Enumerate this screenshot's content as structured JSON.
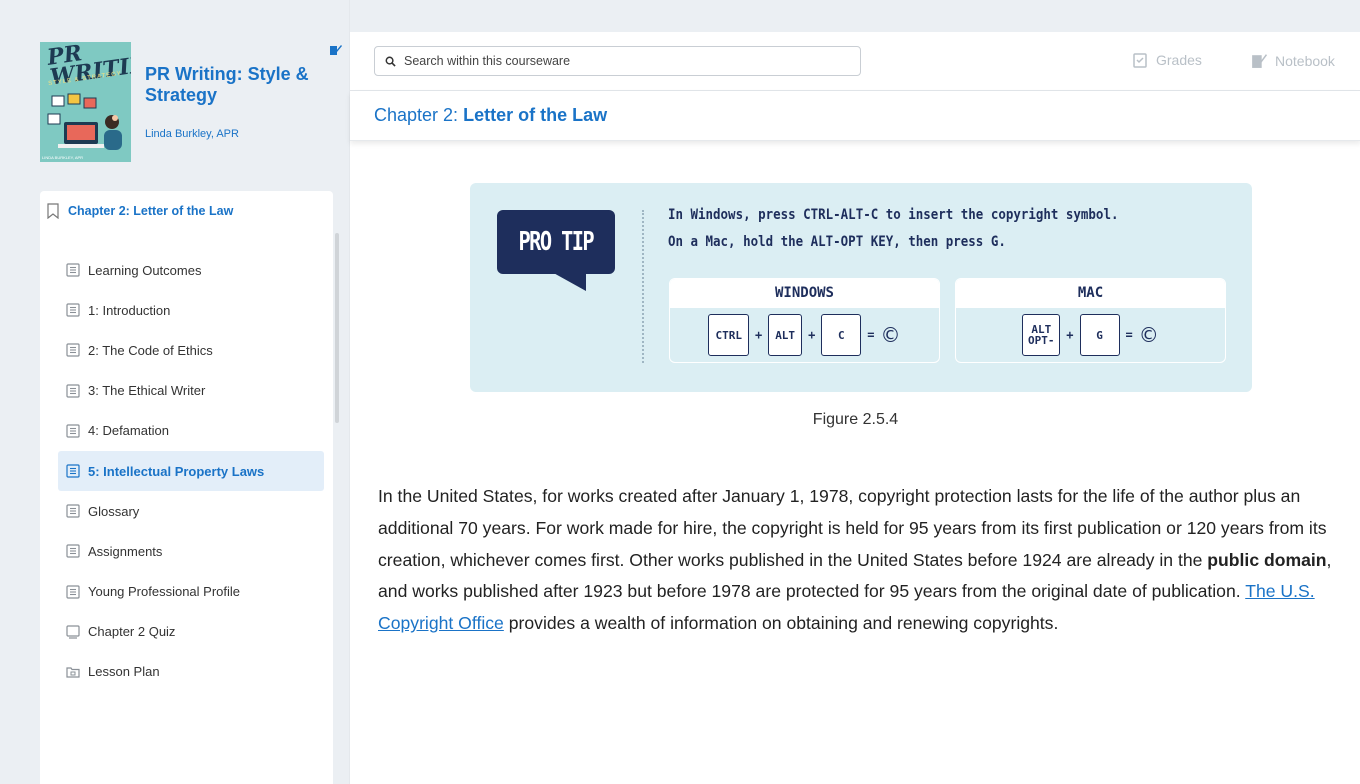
{
  "course": {
    "title": "PR Writing: Style & Strategy",
    "author": "Linda Burkley, APR",
    "cover": {
      "title": "PR WRITING",
      "subtitle": "STYLE & STRATEGY",
      "author": "LINDA BURKLEY, APR"
    }
  },
  "toc": {
    "chapter": "Chapter 2: Letter of the Law",
    "items": [
      {
        "label": "Learning Outcomes",
        "icon": "page-icon",
        "active": false
      },
      {
        "label": "1: Introduction",
        "icon": "page-icon",
        "active": false
      },
      {
        "label": "2: The Code of Ethics",
        "icon": "page-icon",
        "active": false
      },
      {
        "label": "3: The Ethical Writer",
        "icon": "page-icon",
        "active": false
      },
      {
        "label": "4: Defamation",
        "icon": "page-icon",
        "active": false
      },
      {
        "label": "5: Intellectual Property Laws",
        "icon": "page-icon",
        "active": true
      },
      {
        "label": "Glossary",
        "icon": "page-icon",
        "active": false
      },
      {
        "label": "Assignments",
        "icon": "page-icon",
        "active": false
      },
      {
        "label": "Young Professional Profile",
        "icon": "page-icon",
        "active": false
      },
      {
        "label": "Chapter 2 Quiz",
        "icon": "quiz-icon",
        "active": false
      },
      {
        "label": "Lesson Plan",
        "icon": "folder-icon",
        "active": false
      }
    ]
  },
  "toolbar": {
    "search_placeholder": "Search within this courseware",
    "grades_label": "Grades",
    "notebook_label": "Notebook"
  },
  "chapter_bar": {
    "prefix": "Chapter 2:",
    "title": "Letter of the Law"
  },
  "figure": {
    "badge": "PRO TIP",
    "line1": "In Windows, press CTRL-ALT-C to insert the copyright symbol.",
    "line2": "On a Mac, hold the ALT-OPT KEY, then press G.",
    "windows": {
      "heading": "WINDOWS",
      "keys": [
        "CTRL",
        "ALT",
        "C"
      ]
    },
    "mac": {
      "heading": "MAC",
      "keys": [
        "ALT OPT-",
        "G"
      ]
    },
    "plus": "+",
    "equals": "=",
    "symbol": "©",
    "caption": "Figure 2.5.4"
  },
  "body": {
    "part1": "In the United States, for works created after January 1, 1978, copyright protection lasts for the life of the author plus an additional 70 years. For work made for hire, the copyright is held for 95 years from its first publication or 120 years from its creation, whichever comes first. Other works published in the United States before 1924 are already in the ",
    "bold": "public domain",
    "part2": ", and works published after 1923 but before 1978 are protected for 95 years from the original date of publication. ",
    "link": "The U.S. Copyright Office",
    "part3": " provides a wealth of information on obtaining and renewing copyrights."
  },
  "colors": {
    "accent": "#1a73c7",
    "navy": "#1e2e5c",
    "figure_bg": "#dbeef3",
    "active_bg": "#e3eef9"
  }
}
